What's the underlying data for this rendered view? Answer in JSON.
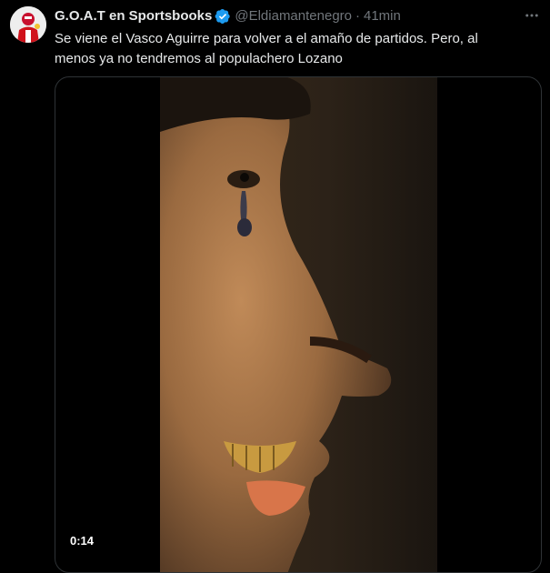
{
  "tweet": {
    "author": {
      "display_name": "G.O.A.T en Sportsbooks",
      "handle": "@Eldiamantenegro",
      "verified": true,
      "avatar_icon": "avatar-icon"
    },
    "separator": "·",
    "timestamp": "41min",
    "more_icon": "more-horizontal-icon",
    "text": "Se viene el Vasco Aguirre para volver a el amaño de partidos. Pero, al\nmenos ya no tendremos al populachero Lozano",
    "media": {
      "type": "video",
      "duration": "0:14"
    }
  },
  "colors": {
    "background": "#000000",
    "text_primary": "#e7e9ea",
    "text_secondary": "#71767b",
    "verified_badge": "#1d9bf0",
    "media_border": "#2f3336"
  }
}
